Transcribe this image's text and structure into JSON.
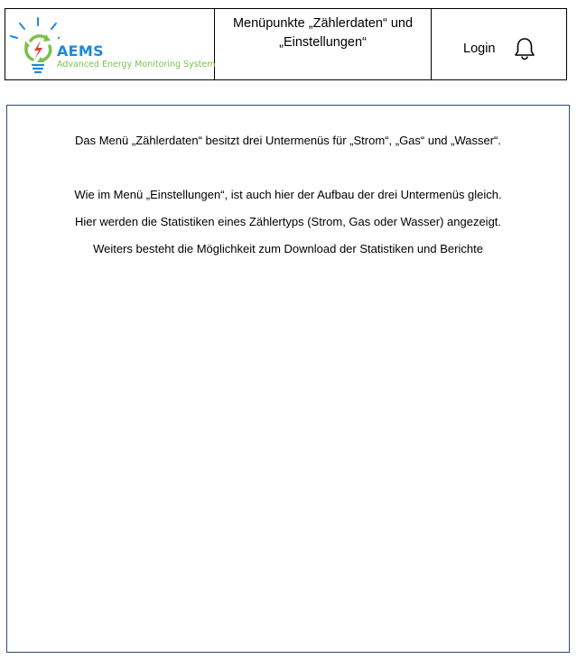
{
  "header": {
    "logo": {
      "name": "AEMS",
      "subtitle": "Advanced Energy Monitoring System"
    },
    "title_line1": "Menüpunkte „Zählerdaten“ und",
    "title_line2": "„Einstellungen“",
    "login_label": "Login",
    "notification_icon": "bell-icon"
  },
  "content": {
    "paragraphs": [
      "Das Menü „Zählerdaten“ besitzt drei Untermenüs für „Strom“, „Gas“ und „Wasser“.",
      "Wie im Menü „Einstellungen“, ist auch hier der Aufbau der drei Untermenüs gleich.",
      "Hier werden die Statistiken eines Zählertyps (Strom, Gas oder Wasser) angezeigt.",
      "Weiters besteht die Möglichkeit zum Download der Statistiken und Berichte"
    ]
  },
  "colors": {
    "logo_blue": "#1e88d9",
    "logo_green": "#7cc04b",
    "logo_red": "#e53935",
    "content_border": "#2f4a78"
  }
}
